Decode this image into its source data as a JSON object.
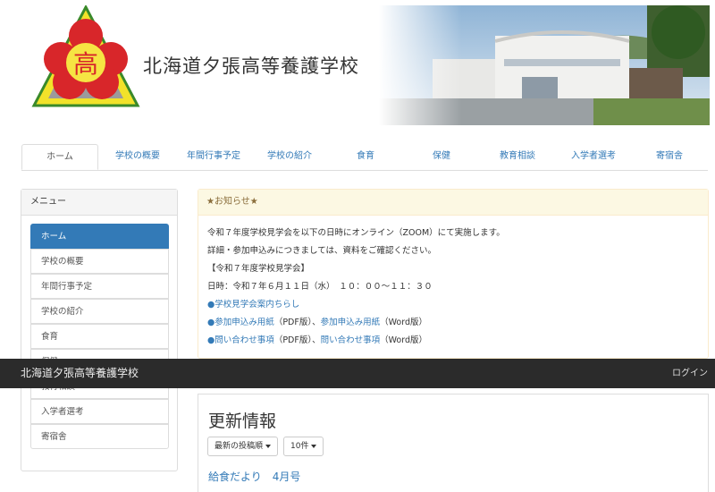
{
  "header": {
    "school_name": "北海道夕張高等養護学校",
    "logo_char": "高"
  },
  "nav": {
    "tabs": [
      {
        "label": "ホーム",
        "active": true
      },
      {
        "label": "学校の概要"
      },
      {
        "label": "年間行事予定"
      },
      {
        "label": "学校の紹介"
      },
      {
        "label": "食育"
      },
      {
        "label": "保健"
      },
      {
        "label": "教育相談"
      },
      {
        "label": "入学者選考"
      },
      {
        "label": "寄宿舎"
      }
    ]
  },
  "sidebar": {
    "heading": "メニュー",
    "items": [
      {
        "label": "ホーム",
        "active": true
      },
      {
        "label": "学校の概要"
      },
      {
        "label": "年間行事予定"
      },
      {
        "label": "学校の紹介"
      },
      {
        "label": "食育"
      },
      {
        "label": "保健"
      },
      {
        "label": "教育相談"
      },
      {
        "label": "入学者選考"
      },
      {
        "label": "寄宿舎"
      }
    ]
  },
  "notice": {
    "heading": "★お知らせ★",
    "line1": "令和７年度学校見学会を以下の日時にオンライン（ZOOM）にて実施します。",
    "line2": "詳細・参加申込みにつきましては、資料をご確認ください。",
    "line3": "【令和７年度学校見学会】",
    "line4": "日時：令和７年６月１１日（水）　１０：００～１１：３０",
    "link1": "学校見学会案内ちらし",
    "link2a": "参加申込み用紙",
    "text2b": "（PDF版）、",
    "link2c": "参加申込み用紙",
    "text2d": "（Word版）",
    "link3a": "問い合わせ事項",
    "text3b": "（PDF版）、",
    "link3c": "問い合わせ事項",
    "text3d": "（Word版）",
    "bullet": "●"
  },
  "darkbar": {
    "title": "北海道夕張高等養護学校",
    "login": "ログイン"
  },
  "updates": {
    "title": "更新情報",
    "sort_label": "最新の投稿順",
    "count_label": "10件",
    "post_title": "給食だより　4月号"
  },
  "colors": {
    "link": "#337ab7",
    "active_menu": "#337ab7",
    "notice_bg": "#fcf8e3",
    "dark_bar": "#2b2b2b"
  }
}
